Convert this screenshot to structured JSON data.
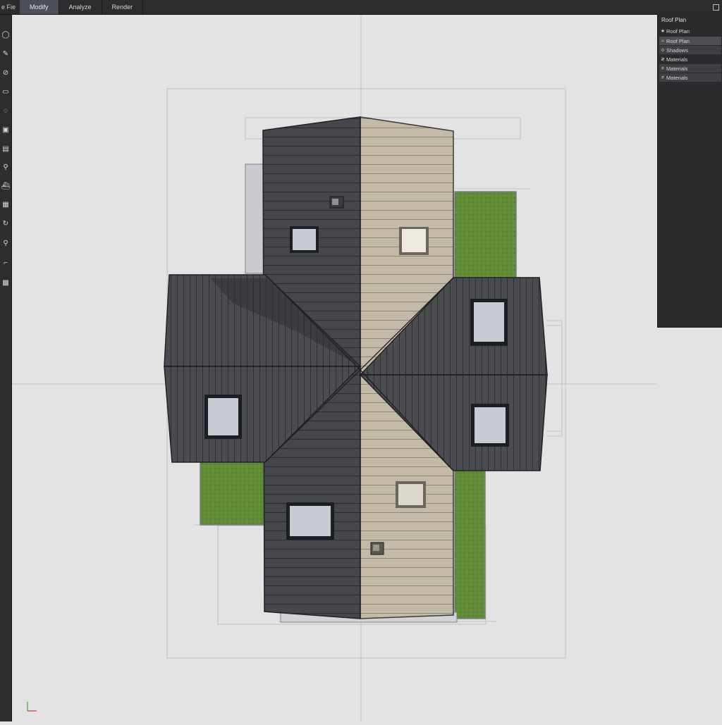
{
  "menubar": {
    "app_label": "e Fie",
    "tabs": [
      {
        "label": "Modify",
        "active": true
      },
      {
        "label": "Analyze",
        "active": false
      },
      {
        "label": "Render",
        "active": false
      }
    ]
  },
  "tools": [
    {
      "name": "circle-tool-icon",
      "glyph": "◯"
    },
    {
      "name": "pencil-tool-icon",
      "glyph": "✎"
    },
    {
      "name": "node-tool-icon",
      "glyph": "⊘"
    },
    {
      "name": "rectangle-tool-icon",
      "glyph": "▭"
    },
    {
      "name": "lasso-tool-icon",
      "glyph": "◌"
    },
    {
      "name": "image-tool-icon",
      "glyph": "▣"
    },
    {
      "name": "frame-tool-icon",
      "glyph": "▤"
    },
    {
      "name": "zoom-tool-icon",
      "glyph": "⚲"
    },
    {
      "name": "paint-tool-icon",
      "glyph": "⛴"
    },
    {
      "name": "table-tool-icon",
      "glyph": "▦"
    },
    {
      "name": "rotate-tool-icon",
      "glyph": "↻"
    },
    {
      "name": "search-tool-icon",
      "glyph": "⚲"
    },
    {
      "name": "crop-tool-icon",
      "glyph": "⌐"
    },
    {
      "name": "grid-tool-icon",
      "glyph": "▩"
    }
  ],
  "panel": {
    "title": "Roof Plan",
    "items": [
      {
        "icon": "★",
        "label": "Roof Plan"
      },
      {
        "icon": "≈",
        "label": "Roof Plan"
      },
      {
        "icon": "≎",
        "label": "Shadows"
      },
      {
        "icon": "≷",
        "label": "Materials"
      },
      {
        "icon": "≠",
        "label": "Materials"
      },
      {
        "icon": "≠",
        "label": "Materials"
      }
    ]
  },
  "colors": {
    "dark_roof": "#45474c",
    "light_roof": "#c2b9a6",
    "grass": "#5f8a36",
    "skylight": "#c7ccd4"
  }
}
